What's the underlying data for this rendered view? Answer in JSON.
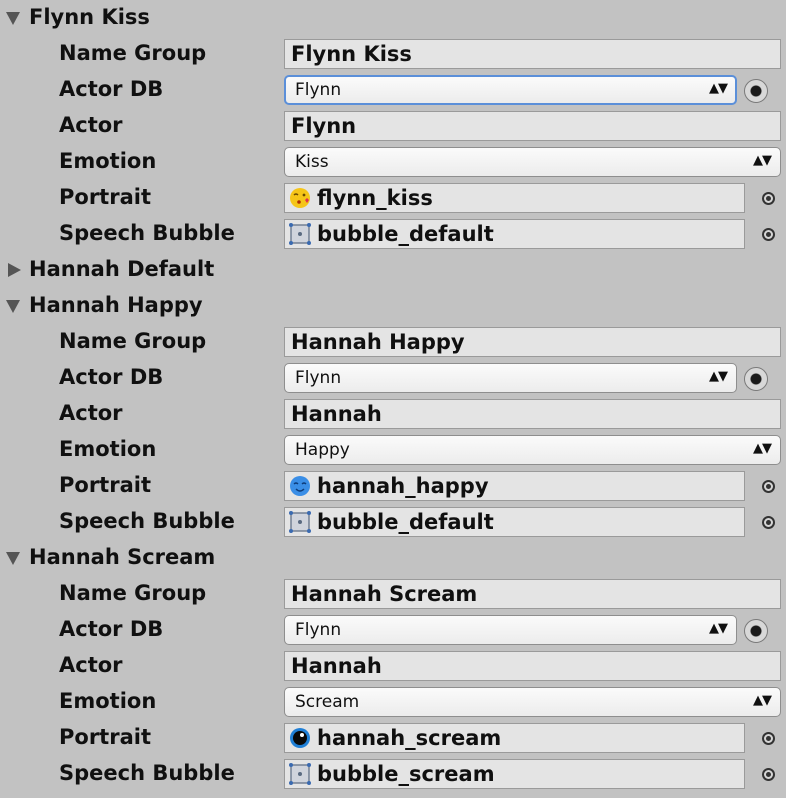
{
  "groups": [
    {
      "title": "Flynn Kiss",
      "expanded": true,
      "labels": {
        "name_group": "Name Group",
        "actor_db": "Actor DB",
        "actor": "Actor",
        "emotion": "Emotion",
        "portrait": "Portrait",
        "speech_bubble": "Speech Bubble"
      },
      "name_group": "Flynn Kiss",
      "actor_db": "Flynn",
      "actor": "Flynn",
      "emotion": "Kiss",
      "portrait": "flynn_kiss",
      "speech_bubble": "bubble_default"
    },
    {
      "title": "Hannah Default",
      "expanded": false
    },
    {
      "title": "Hannah Happy",
      "expanded": true,
      "labels": {
        "name_group": "Name Group",
        "actor_db": "Actor DB",
        "actor": "Actor",
        "emotion": "Emotion",
        "portrait": "Portrait",
        "speech_bubble": "Speech Bubble"
      },
      "name_group": "Hannah Happy",
      "actor_db": "Flynn",
      "actor": "Hannah",
      "emotion": "Happy",
      "portrait": "hannah_happy",
      "speech_bubble": "bubble_default"
    },
    {
      "title": "Hannah Scream",
      "expanded": true,
      "labels": {
        "name_group": "Name Group",
        "actor_db": "Actor DB",
        "actor": "Actor",
        "emotion": "Emotion",
        "portrait": "Portrait",
        "speech_bubble": "Speech Bubble"
      },
      "name_group": "Hannah Scream",
      "actor_db": "Flynn",
      "actor": "Hannah",
      "emotion": "Scream",
      "portrait": "hannah_scream",
      "speech_bubble": "bubble_scream"
    }
  ],
  "icons": {
    "foldout_open": "triangle-down-icon",
    "foldout_closed": "triangle-right-icon",
    "popup_arrows": "up-down-arrows-icon",
    "popup_arrows_glyph": "▲▼",
    "radio": "radio-picker-icon",
    "object_picker": "object-picker-icon",
    "sprite": "sprite-icon"
  },
  "colors": {
    "background": "#c2c2c2",
    "field": "#e4e4e4",
    "focus": "#5b8fd9",
    "flynn_portrait": "#f5c518",
    "hannah_happy_portrait": "#3a8ee6",
    "hannah_scream_portrait": "#1f7fd6"
  }
}
